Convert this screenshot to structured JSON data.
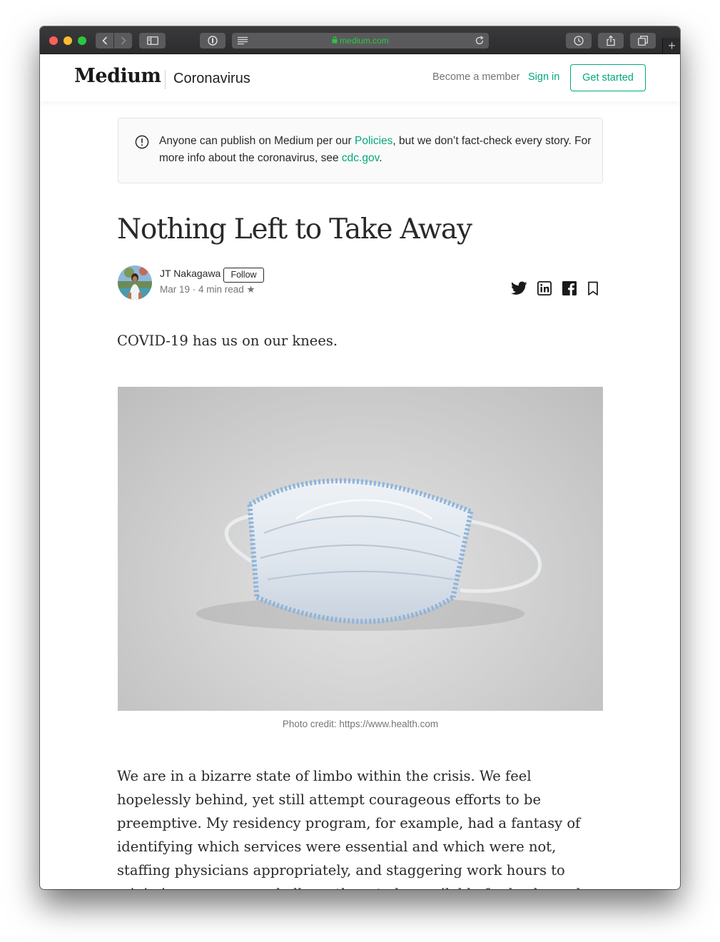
{
  "browser": {
    "url": "medium.com",
    "new_tab_label": "+"
  },
  "header": {
    "logo": "Medium",
    "publication": "Coronavirus",
    "become_member": "Become a member",
    "sign_in": "Sign in",
    "get_started": "Get started"
  },
  "notice": {
    "text_before": "Anyone can publish on Medium per our ",
    "policies_link": "Policies",
    "text_middle": ", but we don’t fact-check every story. For more info about the coronavirus, see ",
    "cdc_link": "cdc.gov",
    "text_after": "."
  },
  "article": {
    "title": "Nothing Left to Take Away",
    "author": "JT Nakagawa",
    "follow_label": "Follow",
    "meta": "Mar 19 · 4 min read ★",
    "lead": "COVID-19 has us on our knees.",
    "photo_caption": "Photo credit: https://www.health.com",
    "body": "We are in a bizarre state of limbo within the crisis. We feel hopelessly behind, yet still attempt courageous efforts to be preemptive. My residency program, for example, had a fantasy of identifying which services were essential and which were not, staffing physicians appropriately, and staggering work hours to minimize exposure and allow others to be available for backup when someone inevitably fell sick, a wise preventive"
  },
  "icons": {
    "share": [
      "twitter-icon",
      "linkedin-icon",
      "facebook-icon",
      "bookmark-icon"
    ]
  },
  "colors": {
    "accent": "#03a87c",
    "text": "#292929",
    "muted": "#757575"
  }
}
